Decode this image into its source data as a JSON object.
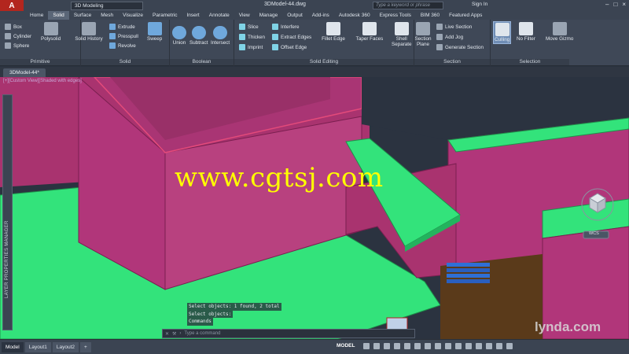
{
  "app": {
    "logo": "A",
    "workspace": "3D Modeling",
    "document_title": "3DModel-44.dwg",
    "search_placeholder": "Type a keyword or phrase",
    "sign_in": "Sign In"
  },
  "ribbon_tabs": [
    "Home",
    "Solid",
    "Surface",
    "Mesh",
    "Visualize",
    "Parametric",
    "Insert",
    "Annotate",
    "View",
    "Manage",
    "Output",
    "Add-ins",
    "Autodesk 360",
    "Express Tools",
    "BIM 360",
    "Featured Apps"
  ],
  "active_tab": "Solid",
  "panels": {
    "primitive": {
      "title": "Primitive",
      "items": [
        "Box",
        "Cylinder",
        "Sphere"
      ],
      "big": [
        "Polysolid"
      ]
    },
    "solid": {
      "title": "Solid",
      "big": [
        "Solid History"
      ],
      "items": [
        "Extrude",
        "Presspull",
        "Revolve"
      ],
      "big2": [
        "Sweep"
      ]
    },
    "boolean": {
      "title": "Boolean",
      "big": [
        "Union",
        "Subtract",
        "Intersect"
      ]
    },
    "solid_editing": {
      "title": "Solid Editing",
      "items": [
        "Slice",
        "Thicken",
        "Imprint",
        "Interfere",
        "Extract Edges",
        "Offset Edge"
      ],
      "big": [
        "Fillet Edge",
        "Taper Faces",
        "Shell",
        "Separate"
      ]
    },
    "section": {
      "title": "Section",
      "big": [
        "Section Plane"
      ],
      "items": [
        "Live Section",
        "Add Jog",
        "Generate Section"
      ]
    },
    "selection": {
      "title": "Selection",
      "big": [
        "Culling",
        "No Filter",
        "Move Gizmo"
      ]
    }
  },
  "file_tab": "3DModel-44*",
  "viewport_label": "[+][Custom View][Shaded with edges]",
  "palette_label": "LAYER PROPERTIES MANAGER",
  "command_history": [
    "Select objects: 1 found, 2 total",
    "Select objects:",
    "Commands"
  ],
  "command_placeholder": "Type a command",
  "watermark": "www.cgtsj.com",
  "lynda": "lynda.com",
  "layout_tabs": [
    "Model",
    "Layout1",
    "Layout2"
  ],
  "status": {
    "model": "MODEL"
  },
  "viewcube": {
    "label": "WCS"
  },
  "colors": {
    "solid_magenta": "#b1367a",
    "solid_green": "#33e37b",
    "floor_brown": "#5a3a1a",
    "stairs_blue": "#2f6fd6"
  }
}
